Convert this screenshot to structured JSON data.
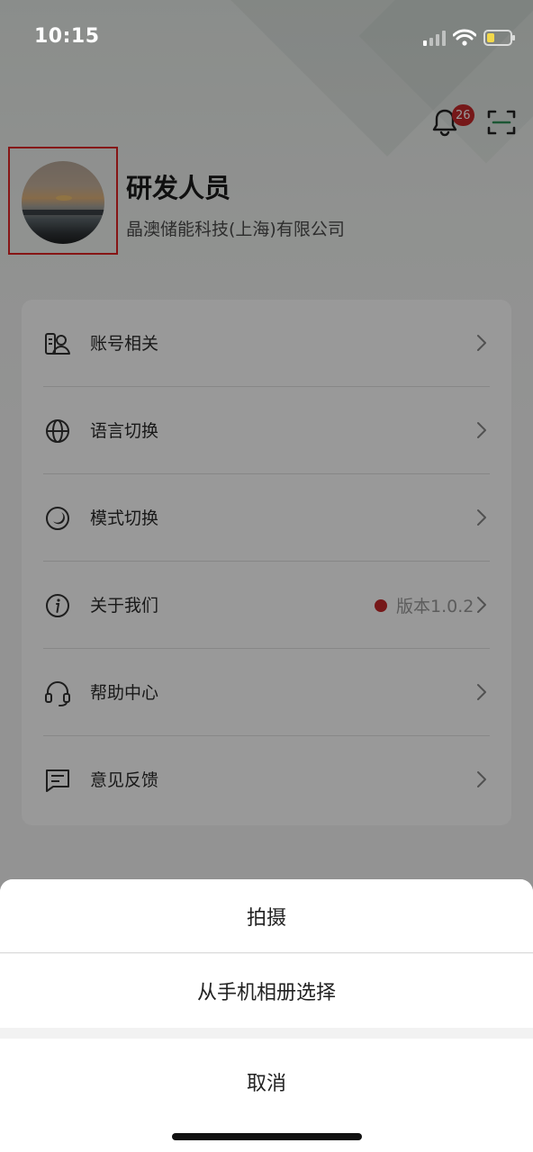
{
  "status_bar": {
    "time": "10:15"
  },
  "header": {
    "notification_count": "26"
  },
  "profile": {
    "name": "研发人员",
    "company": "晶澳储能科技(上海)有限公司"
  },
  "menu": {
    "items": [
      {
        "label": "账号相关",
        "icon": "account-icon"
      },
      {
        "label": "语言切换",
        "icon": "globe-icon"
      },
      {
        "label": "模式切换",
        "icon": "theme-mode-icon"
      },
      {
        "label": "关于我们",
        "icon": "info-icon",
        "version": "版本1.0.2"
      },
      {
        "label": "帮助中心",
        "icon": "headset-icon"
      },
      {
        "label": "意见反馈",
        "icon": "feedback-icon"
      }
    ]
  },
  "action_sheet": {
    "take_photo": "拍摄",
    "choose_album": "从手机相册选择",
    "cancel": "取消"
  },
  "colors": {
    "badge": "#c5282b",
    "highlight_frame": "#e02424",
    "overlay": "rgba(0,0,0,0.40)"
  }
}
